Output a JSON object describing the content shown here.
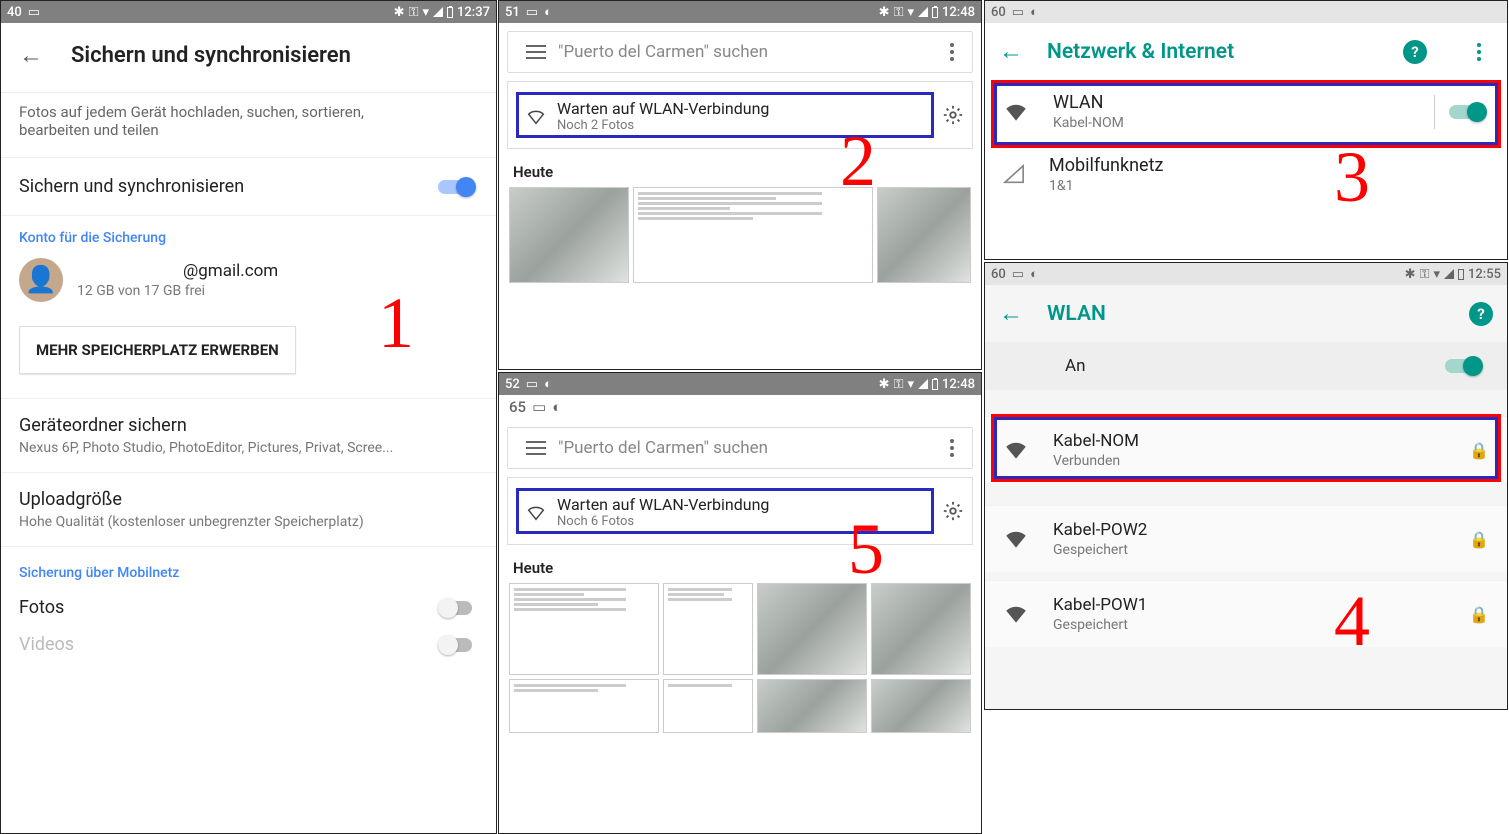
{
  "panel1": {
    "status": {
      "count": "40",
      "time": "12:37"
    },
    "header_title": "Sichern und synchronisieren",
    "description": "Fotos auf jedem Gerät hochladen, suchen, sortieren,\nbearbeiten und teilen",
    "toggle_label": "Sichern und synchronisieren",
    "account_section": "Konto für die Sicherung",
    "account": {
      "email": "@gmail.com",
      "storage": "12 GB von 17 GB frei"
    },
    "buy_storage": "MEHR SPEICHERPLATZ ERWERBEN",
    "device_folders": {
      "title": "Geräteordner sichern",
      "sub": "Nexus 6P, Photo Studio, PhotoEditor, Pictures, Privat, Scree..."
    },
    "upload_size": {
      "title": "Uploadgröße",
      "sub": "Hohe Qualität (kostenloser unbegrenzter Speicherplatz)"
    },
    "mobile_section": "Sicherung über Mobilnetz",
    "mobile_photos": "Fotos",
    "mobile_videos": "Videos"
  },
  "panel2": {
    "status": {
      "count": "51",
      "time": "12:48"
    },
    "search_placeholder": "\"Puerto del Carmen\" suchen",
    "wlan_title": "Warten auf WLAN-Verbindung",
    "wlan_sub": "Noch 2 Fotos",
    "section": "Heute"
  },
  "panel5": {
    "status": {
      "count": "52",
      "time": "12:48"
    },
    "inner_count": "65",
    "search_placeholder": "\"Puerto del Carmen\" suchen",
    "wlan_title": "Warten auf WLAN-Verbindung",
    "wlan_sub": "Noch 6 Fotos",
    "section": "Heute"
  },
  "panel3": {
    "status": {
      "count": "60"
    },
    "title": "Netzwerk & Internet",
    "wlan": {
      "title": "WLAN",
      "sub": "Kabel-NOM"
    },
    "mobile": {
      "title": "Mobilfunknetz",
      "sub": "1&1"
    }
  },
  "panel4": {
    "status": {
      "count": "60",
      "time": "12:55"
    },
    "title": "WLAN",
    "on_label": "An",
    "networks": [
      {
        "name": "Kabel-NOM",
        "sub": "Verbunden"
      },
      {
        "name": "Kabel-POW2",
        "sub": "Gespeichert"
      },
      {
        "name": "Kabel-POW1",
        "sub": "Gespeichert"
      }
    ]
  },
  "annotations": {
    "n1": "1",
    "n2": "2",
    "n3": "3",
    "n4": "4",
    "n5": "5"
  }
}
